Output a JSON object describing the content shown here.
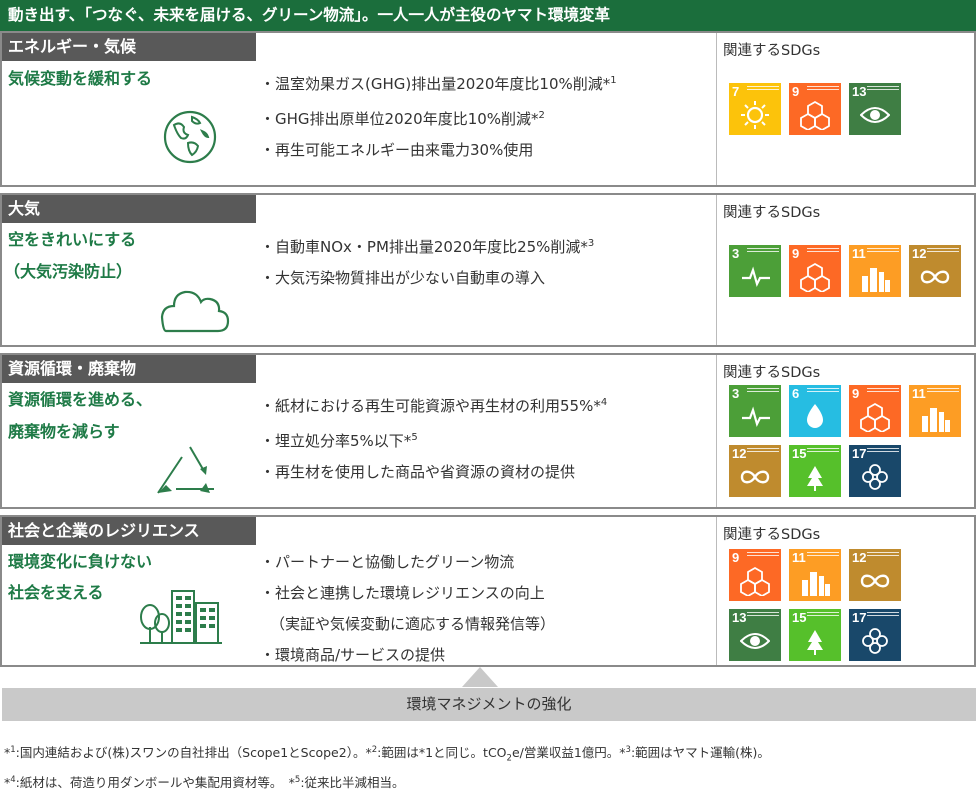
{
  "banner": "動き出す、「つなぐ、未来を届ける、グリーン物流」。一人一人が主役のヤマト環境変革",
  "sdg_heading": "関連するSDGs",
  "sections": [
    {
      "category": "エネルギー・気候",
      "goal_line1": "気候変動を緩和する",
      "goal_line2": "",
      "actions": [
        {
          "text": "・温室効果ガス(GHG)排出量2020年度比10%削減*",
          "sup": "1"
        },
        {
          "text": "・GHG排出原単位2020年度比10%削減*",
          "sup": "2"
        },
        {
          "text": "・再生可能エネルギー由来電力30%使用",
          "sup": ""
        }
      ],
      "sdgs": [
        "7",
        "9",
        "13"
      ]
    },
    {
      "category": "大気",
      "goal_line1": "空をきれいにする",
      "goal_line2": "（大気汚染防止）",
      "actions": [
        {
          "text": "・自動車NOx・PM排出量2020年度比25%削減*",
          "sup": "3"
        },
        {
          "text": "・大気汚染物質排出が少ない自動車の導入",
          "sup": ""
        }
      ],
      "sdgs": [
        "3",
        "9",
        "11",
        "12"
      ]
    },
    {
      "category": "資源循環・廃棄物",
      "goal_line1": "資源循環を進める、",
      "goal_line2": "廃棄物を減らす",
      "actions": [
        {
          "text": "・紙材における再生可能資源や再生材の利用55%*",
          "sup": "4"
        },
        {
          "text": "・埋立処分率5%以下*",
          "sup": "5"
        },
        {
          "text": "・再生材を使用した商品や省資源の資材の提供",
          "sup": ""
        }
      ],
      "sdgs": [
        "3",
        "6",
        "9",
        "11",
        "12",
        "15",
        "17"
      ]
    },
    {
      "category": "社会と企業のレジリエンス",
      "goal_line1": "環境変化に負けない",
      "goal_line2": "社会を支える",
      "actions": [
        {
          "text": "・パートナーと協働したグリーン物流",
          "sup": ""
        },
        {
          "text": "・社会と連携した環境レジリエンスの向上",
          "sup": ""
        },
        {
          "text": "（実証や気候変動に適応する情報発信等）",
          "sup": ""
        },
        {
          "text": "・環境商品/サービスの提供",
          "sup": ""
        }
      ],
      "sdgs": [
        "9",
        "11",
        "12",
        "13",
        "15",
        "17"
      ]
    }
  ],
  "sdg_colors": {
    "3": "#4c9f38",
    "6": "#26bde2",
    "7": "#fcc30b",
    "9": "#fd6925",
    "11": "#fd9d24",
    "12": "#bf8b2e",
    "13": "#3f7e44",
    "15": "#56c02b",
    "17": "#19486a"
  },
  "bottom_bar": "環境マネジメントの強化",
  "footnote1": {
    "a_sup": "1",
    "a": ":国内連結および(株)スワンの自社排出（Scope1とScope2）。",
    "b_sup": "2",
    "b": ":範囲は*1と同じ。tCO",
    "b_sub": "2",
    "b2": "e/営業収益1億円。",
    "c_sup": "3",
    "c": ":範囲はヤマト運輸(株)。"
  },
  "footnote2": {
    "a_sup": "4",
    "a": ":紙材は、荷造り用ダンボールや集配用資材等。",
    "b_sup": "5",
    "b": ":従来比半減相当。"
  }
}
